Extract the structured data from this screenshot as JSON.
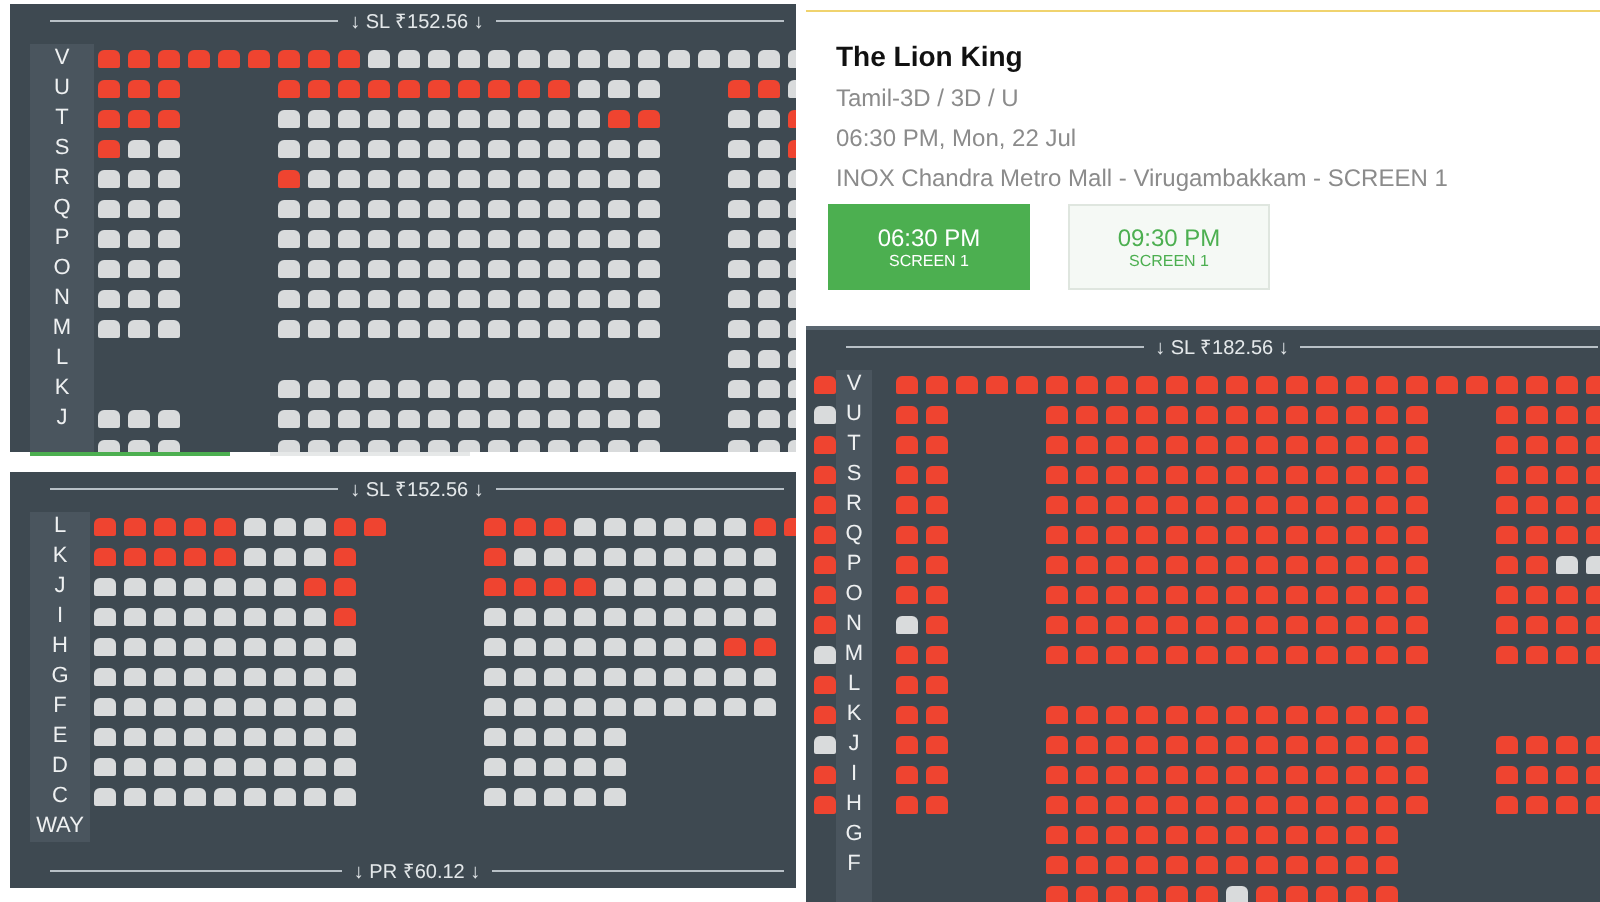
{
  "left": {
    "top_map": {
      "header": "↓ SL ₹152.56 ↓",
      "rows": [
        {
          "label": "V",
          "seats": [
            true,
            true,
            true,
            true,
            true,
            true,
            true,
            true,
            true,
            false,
            false,
            false,
            false,
            false,
            false,
            false,
            false,
            false,
            false,
            false,
            false,
            false,
            false,
            false
          ]
        },
        {
          "label": "U",
          "left": [
            true,
            true,
            true
          ],
          "center": [
            true,
            true,
            true,
            true,
            true,
            true,
            true,
            true,
            true,
            true,
            false,
            false,
            false
          ],
          "right": [
            true,
            true,
            false
          ]
        },
        {
          "label": "T",
          "left": [
            true,
            true,
            true
          ],
          "center": [
            false,
            false,
            false,
            false,
            false,
            false,
            false,
            false,
            false,
            false,
            false,
            true,
            true
          ],
          "right": [
            false,
            false,
            true
          ]
        },
        {
          "label": "S",
          "left": [
            true,
            false,
            false
          ],
          "center": [
            false,
            false,
            false,
            false,
            false,
            false,
            false,
            false,
            false,
            false,
            false,
            false,
            false
          ],
          "right": [
            false,
            false,
            true
          ]
        },
        {
          "label": "R",
          "left": [
            false,
            false,
            false
          ],
          "center": [
            true,
            false,
            false,
            false,
            false,
            false,
            false,
            false,
            false,
            false,
            false,
            false,
            false
          ],
          "right": [
            false,
            false,
            false
          ]
        },
        {
          "label": "Q",
          "left": [
            false,
            false,
            false
          ],
          "center": [
            false,
            false,
            false,
            false,
            false,
            false,
            false,
            false,
            false,
            false,
            false,
            false,
            false
          ],
          "right": [
            false,
            false,
            false
          ]
        },
        {
          "label": "P",
          "left": [
            false,
            false,
            false
          ],
          "center": [
            false,
            false,
            false,
            false,
            false,
            false,
            false,
            false,
            false,
            false,
            false,
            false,
            false
          ],
          "right": [
            false,
            false,
            false
          ]
        },
        {
          "label": "O",
          "left": [
            false,
            false,
            false
          ],
          "center": [
            false,
            false,
            false,
            false,
            false,
            false,
            false,
            false,
            false,
            false,
            false,
            false,
            false
          ],
          "right": [
            false,
            false,
            false
          ]
        },
        {
          "label": "N",
          "left": [
            false,
            false,
            false
          ],
          "center": [
            false,
            false,
            false,
            false,
            false,
            false,
            false,
            false,
            false,
            false,
            false,
            false,
            false
          ],
          "right": [
            false,
            false,
            false
          ]
        },
        {
          "label": "M",
          "left": [
            false,
            false,
            false
          ],
          "center": [
            false,
            false,
            false,
            false,
            false,
            false,
            false,
            false,
            false,
            false,
            false,
            false,
            false
          ],
          "right": [
            false,
            false,
            false
          ]
        },
        {
          "label": "L",
          "right": [
            false,
            false,
            false
          ]
        },
        {
          "label": "K",
          "center": [
            false,
            false,
            false,
            false,
            false,
            false,
            false,
            false,
            false,
            false,
            false,
            false,
            false
          ],
          "right": [
            false,
            false,
            false
          ]
        },
        {
          "label": "J",
          "left": [
            false,
            false,
            false
          ],
          "center": [
            false,
            false,
            false,
            false,
            false,
            false,
            false,
            false,
            false,
            false,
            false,
            false,
            false
          ],
          "right": [
            false,
            false,
            false
          ]
        },
        {
          "left": [
            false,
            false,
            false
          ],
          "center": [
            false,
            false,
            false,
            false,
            false,
            false,
            false,
            false,
            false,
            false,
            false,
            false,
            false
          ],
          "right": [
            false,
            false,
            false
          ]
        }
      ]
    },
    "tabs": [
      {
        "selected": true
      },
      {
        "selected": false
      }
    ],
    "bottom_map": {
      "header": "↓ SL ₹152.56 ↓",
      "rows": [
        {
          "label": "L",
          "left": [
            true,
            true,
            true,
            true,
            true,
            false,
            false,
            false,
            true,
            true
          ],
          "right": [
            true,
            true,
            true,
            false,
            false,
            false,
            false,
            false,
            false,
            true,
            true
          ]
        },
        {
          "label": "K",
          "left": [
            true,
            true,
            true,
            true,
            true,
            false,
            false,
            false,
            true
          ],
          "right": [
            true,
            false,
            false,
            false,
            false,
            false,
            false,
            false,
            false,
            false
          ]
        },
        {
          "label": "J",
          "left": [
            false,
            false,
            false,
            false,
            false,
            false,
            false,
            true,
            true
          ],
          "right": [
            true,
            true,
            true,
            true,
            false,
            false,
            false,
            false,
            false,
            false
          ]
        },
        {
          "label": "I",
          "left": [
            false,
            false,
            false,
            false,
            false,
            false,
            false,
            false,
            true
          ],
          "right": [
            false,
            false,
            false,
            false,
            false,
            false,
            false,
            false,
            false,
            false
          ]
        },
        {
          "label": "H",
          "left": [
            false,
            false,
            false,
            false,
            false,
            false,
            false,
            false,
            false
          ],
          "right": [
            false,
            false,
            false,
            false,
            false,
            false,
            false,
            false,
            true,
            true
          ]
        },
        {
          "label": "G",
          "left": [
            false,
            false,
            false,
            false,
            false,
            false,
            false,
            false,
            false
          ],
          "right": [
            false,
            false,
            false,
            false,
            false,
            false,
            false,
            false,
            false,
            false
          ]
        },
        {
          "label": "F",
          "left": [
            false,
            false,
            false,
            false,
            false,
            false,
            false,
            false,
            false
          ],
          "right": [
            false,
            false,
            false,
            false,
            false,
            false,
            false,
            false,
            false,
            false
          ]
        },
        {
          "label": "E",
          "left": [
            false,
            false,
            false,
            false,
            false,
            false,
            false,
            false,
            false
          ],
          "right": [
            false,
            false,
            false,
            false,
            false
          ]
        },
        {
          "label": "D",
          "left": [
            false,
            false,
            false,
            false,
            false,
            false,
            false,
            false,
            false
          ],
          "right": [
            false,
            false,
            false,
            false,
            false
          ]
        },
        {
          "label": "C",
          "left": [
            false,
            false,
            false,
            false,
            false,
            false,
            false,
            false,
            false
          ],
          "right": [
            false,
            false,
            false,
            false,
            false
          ]
        },
        {
          "label": "WAY"
        }
      ],
      "footer": "↓ PR ₹60.12 ↓"
    }
  },
  "right": {
    "details": {
      "title": "The Lion King",
      "format": "Tamil-3D / 3D / U",
      "datetime": "06:30 PM, Mon, 22 Jul",
      "venue": "INOX Chandra Metro Mall - Virugambakkam - SCREEN 1",
      "showtimes": [
        {
          "time": "06:30 PM",
          "screen": "SCREEN 1",
          "selected": true
        },
        {
          "time": "09:30 PM",
          "screen": "SCREEN 1",
          "selected": false
        }
      ]
    },
    "map": {
      "header": "↓ SL ₹182.56 ↓",
      "rows": [
        {
          "label": "V",
          "edge": true,
          "seats": [
            true,
            true,
            true,
            true,
            true,
            true,
            true,
            true,
            true,
            true,
            true,
            true,
            true,
            true,
            true,
            true,
            true,
            true,
            true,
            true,
            true,
            true,
            true,
            true
          ]
        },
        {
          "label": "U",
          "edge": false,
          "left": [
            true,
            true
          ],
          "center": [
            true,
            true,
            true,
            true,
            true,
            true,
            true,
            true,
            true,
            true,
            true,
            true,
            true
          ],
          "right": [
            true,
            true,
            true,
            true
          ]
        },
        {
          "label": "T",
          "edge": true,
          "left": [
            true,
            true
          ],
          "center": [
            true,
            true,
            true,
            true,
            true,
            true,
            true,
            true,
            true,
            true,
            true,
            true,
            true
          ],
          "right": [
            true,
            true,
            true,
            true
          ]
        },
        {
          "label": "S",
          "edge": true,
          "left": [
            true,
            true
          ],
          "center": [
            true,
            true,
            true,
            true,
            true,
            true,
            true,
            true,
            true,
            true,
            true,
            true,
            true
          ],
          "right": [
            true,
            true,
            true,
            true
          ]
        },
        {
          "label": "R",
          "edge": true,
          "left": [
            true,
            true
          ],
          "center": [
            true,
            true,
            true,
            true,
            true,
            true,
            true,
            true,
            true,
            true,
            true,
            true,
            true
          ],
          "right": [
            true,
            true,
            true,
            true
          ]
        },
        {
          "label": "Q",
          "edge": true,
          "left": [
            true,
            true
          ],
          "center": [
            true,
            true,
            true,
            true,
            true,
            true,
            true,
            true,
            true,
            true,
            true,
            true,
            true
          ],
          "right": [
            true,
            true,
            true,
            true
          ]
        },
        {
          "label": "P",
          "edge": true,
          "left": [
            true,
            true
          ],
          "center": [
            true,
            true,
            true,
            true,
            true,
            true,
            true,
            true,
            true,
            true,
            true,
            true,
            true
          ],
          "right": [
            true,
            true,
            false,
            false
          ]
        },
        {
          "label": "O",
          "edge": true,
          "left": [
            true,
            true
          ],
          "center": [
            true,
            true,
            true,
            true,
            true,
            true,
            true,
            true,
            true,
            true,
            true,
            true,
            true
          ],
          "right": [
            true,
            true,
            true,
            true
          ]
        },
        {
          "label": "N",
          "edge": true,
          "left": [
            false,
            true
          ],
          "center": [
            true,
            true,
            true,
            true,
            true,
            true,
            true,
            true,
            true,
            true,
            true,
            true,
            true
          ],
          "right": [
            true,
            true,
            true,
            true
          ]
        },
        {
          "label": "M",
          "edge": false,
          "left": [
            true,
            true
          ],
          "center": [
            true,
            true,
            true,
            true,
            true,
            true,
            true,
            true,
            true,
            true,
            true,
            true,
            true
          ],
          "right": [
            true,
            true,
            true,
            true
          ]
        },
        {
          "label": "L",
          "edge": true,
          "left": [
            true,
            true
          ]
        },
        {
          "label": "K",
          "edge": true,
          "left": [
            true,
            true
          ],
          "center": [
            true,
            true,
            true,
            true,
            true,
            true,
            true,
            true,
            true,
            true,
            true,
            true,
            true
          ]
        },
        {
          "label": "J",
          "edge": false,
          "left": [
            true,
            true
          ],
          "center": [
            true,
            true,
            true,
            true,
            true,
            true,
            true,
            true,
            true,
            true,
            true,
            true,
            true
          ],
          "right": [
            true,
            true,
            true,
            true
          ]
        },
        {
          "label": "I",
          "edge": true,
          "left": [
            true,
            true
          ],
          "center": [
            true,
            true,
            true,
            true,
            true,
            true,
            true,
            true,
            true,
            true,
            true,
            true,
            true
          ],
          "right": [
            true,
            true,
            true,
            true
          ]
        },
        {
          "label": "H",
          "edge": true,
          "left": [
            true,
            true
          ],
          "center": [
            true,
            true,
            true,
            true,
            true,
            true,
            true,
            true,
            true,
            true,
            true,
            true,
            true
          ],
          "right": [
            true,
            true,
            true,
            true
          ]
        },
        {
          "label": "G",
          "center": [
            true,
            true,
            true,
            true,
            true,
            true,
            true,
            true,
            true,
            true,
            true,
            true
          ]
        },
        {
          "label": "F",
          "center": [
            true,
            true,
            true,
            true,
            true,
            true,
            true,
            true,
            true,
            true,
            true,
            true
          ]
        },
        {
          "center": [
            true,
            true,
            true,
            true,
            true,
            true,
            false,
            true,
            true,
            true,
            true,
            true
          ]
        }
      ]
    }
  }
}
